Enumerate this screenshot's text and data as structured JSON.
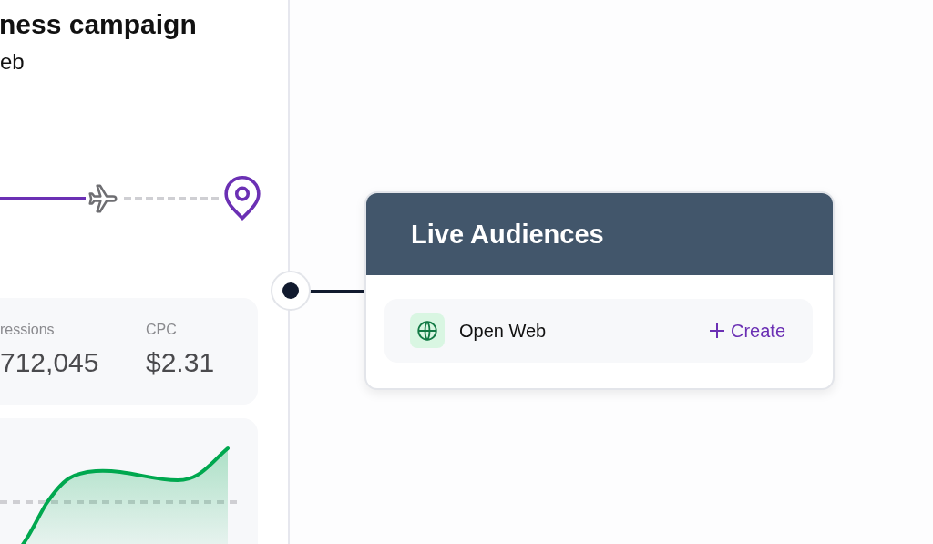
{
  "campaign": {
    "title": "ness campaign",
    "channel": "eb"
  },
  "stats": [
    {
      "label": "ressions",
      "value": "712,045"
    },
    {
      "label": "CPC",
      "value": "$2.31"
    }
  ],
  "audience_card": {
    "title": "Live Audiences",
    "items": [
      {
        "name": "Open Web",
        "action": "Create"
      }
    ]
  }
}
